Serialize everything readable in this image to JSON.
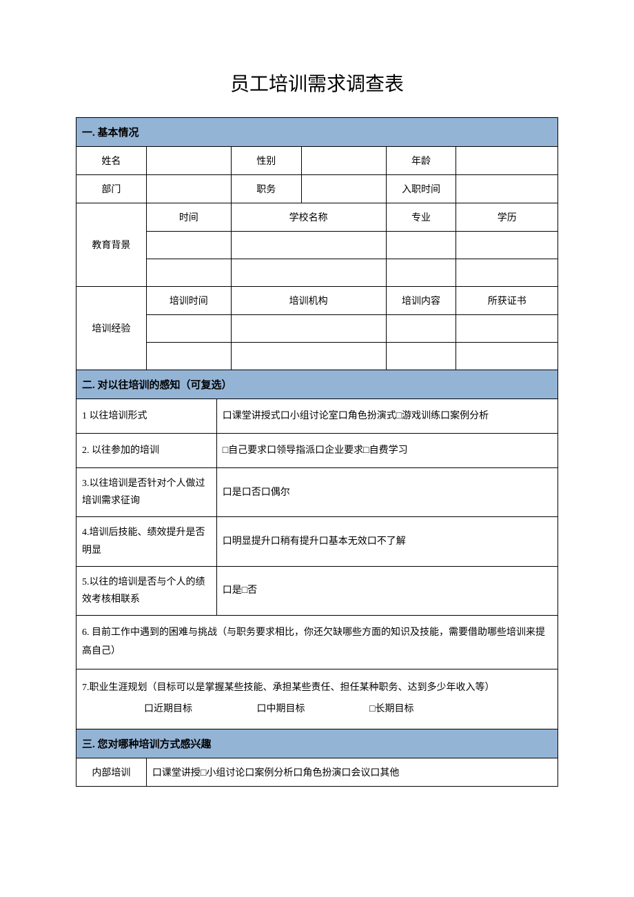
{
  "title": "员工培训需求调查表",
  "section1": {
    "header": "一. 基本情况",
    "name": "姓名",
    "gender": "性别",
    "age": "年龄",
    "dept": "部门",
    "position": "职务",
    "joinDate": "入职时间",
    "edu": {
      "label": "教育背景",
      "time": "时间",
      "school": "学校名称",
      "major": "专业",
      "degree": "学历"
    },
    "training": {
      "label": "培训经验",
      "time": "培训时间",
      "org": "培训机构",
      "content": "培训内容",
      "cert": "所获证书"
    }
  },
  "section2": {
    "header": "二. 对以往培训的感知（可复选）",
    "q1": {
      "label": "1 以往培训形式",
      "options": "口课堂讲授式口小组讨论室口角色扮演式□游戏训练口案例分析"
    },
    "q2": {
      "label": "2. 以往参加的培训",
      "options": "□自己要求口领导指派口企业要求□自费学习"
    },
    "q3": {
      "label": "3.以往培训是否针对个人做过培训需求征询",
      "options": "口是口否口偶尔"
    },
    "q4": {
      "label": "4.培训后技能、绩效提升是否明显",
      "options": "口明显提升口稍有提升口基本无效口不了解"
    },
    "q5": {
      "label": "5.以往的培训是否与个人的绩效考核相联系",
      "options": "口是□否"
    },
    "q6": "6. 目前工作中遇到的困难与挑战（与职务要求相比，你还欠缺哪些方面的知识及技能，需要借助哪些培训来提高自己）",
    "q7": {
      "text": "7.职业生涯规划（目标可以是掌握某些技能、承担某些责任、担任某种职务、达到多少年收入等）",
      "g1": "口近期目标",
      "g2": "口中期目标",
      "g3": "□长期目标"
    }
  },
  "section3": {
    "header": "三. 您对哪种培训方式感兴趣",
    "internal": {
      "label": "内部培训",
      "options": "口课堂讲授□小组讨论口案例分析口角色扮演口会议口其他"
    }
  }
}
